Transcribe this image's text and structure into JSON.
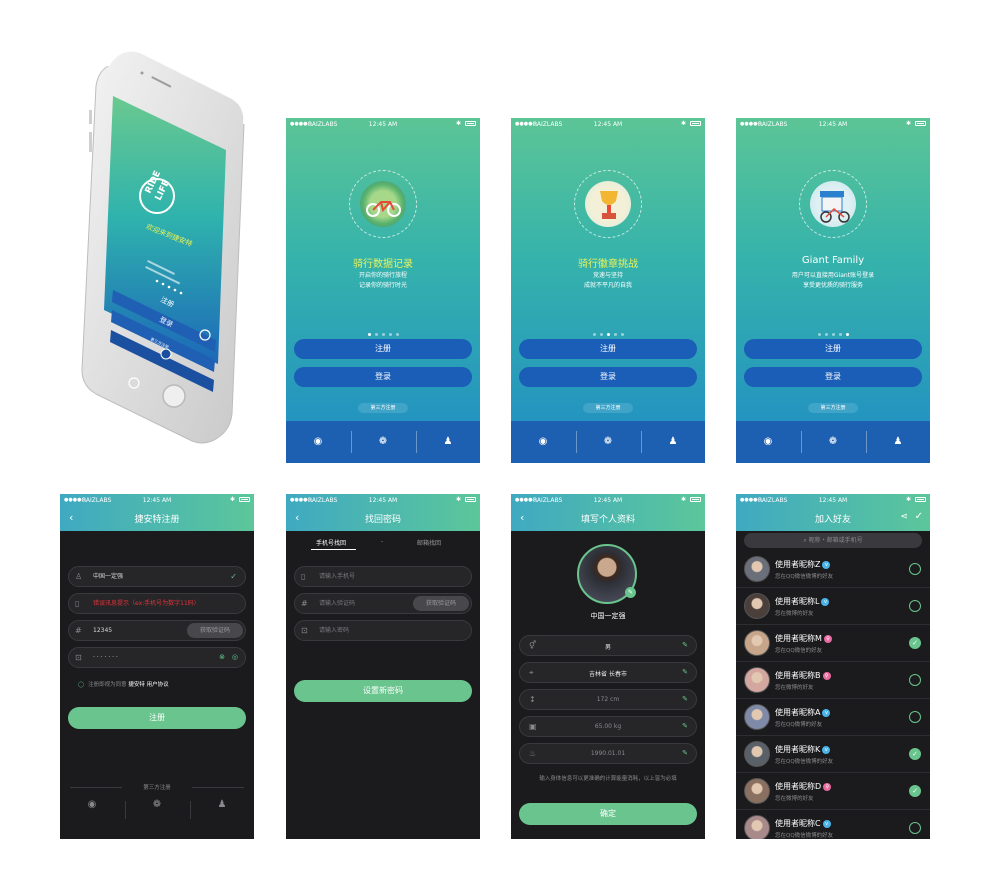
{
  "status": {
    "carrier": "RAIZLABS",
    "time": "12:45 AM"
  },
  "phone_mockup": {
    "logo_line1": "RIDE",
    "logo_line2": "LIFE",
    "welcome": "欢迎来到捷安特",
    "register": "注册",
    "login": "登录",
    "third_party": "第三方注册"
  },
  "onboarding": [
    {
      "title": "骑行数据记录",
      "desc": [
        "开启你的骑行旅程",
        "记录你的骑行时光"
      ],
      "active_page": 1,
      "accent": "#4aa86a"
    },
    {
      "title": "骑行徽章挑战",
      "desc": [
        "竞速与坚持",
        "成就不平凡的自我"
      ],
      "active_page": 3,
      "accent": "#e84a3a"
    },
    {
      "title": "Giant Family",
      "desc": [
        "用户可以直接用Giant账号登录",
        "享受更优质的骑行服务"
      ],
      "active_page": 5,
      "accent": "#2a7fcf"
    }
  ],
  "common": {
    "register": "注册",
    "login": "登录",
    "third_party": "第三方注册",
    "page_count": 5
  },
  "register_screen": {
    "title": "捷安特注册",
    "name_value": "中国一定强",
    "error_text": "错误讯息提示（ex:手机号为数字11码）",
    "code_value": "12345",
    "get_code": "获取验证码",
    "password_mask": "· · · · · · ·",
    "agree_prefix": "注册即视为同意",
    "agree_link": "捷安特 用户协议",
    "submit": "注册",
    "third_party": "第三方注册"
  },
  "recover_screen": {
    "title": "找回密码",
    "tab_phone": "手机号找回",
    "tab_sep": "-",
    "tab_email": "邮箱找回",
    "phone_placeholder": "请输入手机号",
    "code_placeholder": "请输入验证码",
    "get_code": "获取验证码",
    "password_placeholder": "请输入密码",
    "submit": "设置新密码"
  },
  "profile_screen": {
    "title": "填写个人资料",
    "name": "中国一定强",
    "gender": "男",
    "region": "吉林省 长春市",
    "height": "172 cm",
    "weight": "65.00 kg",
    "birthday": "1990.01.01",
    "note": "输入身体信息可以更准确的计算能量消耗，以上皆为必填",
    "submit": "确定"
  },
  "friends_screen": {
    "title": "加入好友",
    "search_placeholder": "昵称・邮箱或手机号",
    "friends": [
      {
        "name": "使用者昵称Z",
        "sub": "您在QQ微信微博的好友",
        "badge": "v",
        "badge_color": "#4ab3e8",
        "checked": false
      },
      {
        "name": "使用者昵称L",
        "sub": "您在微博的好友",
        "badge": "v",
        "badge_color": "#4ab3e8",
        "checked": false
      },
      {
        "name": "使用者昵称M",
        "sub": "您在QQ微信的好友",
        "badge": "♀",
        "badge_color": "#e86aa0",
        "checked": true
      },
      {
        "name": "使用者昵称B",
        "sub": "您在微博的好友",
        "badge": "♀",
        "badge_color": "#e86aa0",
        "checked": false
      },
      {
        "name": "使用者昵称A",
        "sub": "您在QQ微博的好友",
        "badge": "v",
        "badge_color": "#4ab3e8",
        "checked": false
      },
      {
        "name": "使用者昵称K",
        "sub": "您在QQ微信微博的好友",
        "badge": "v",
        "badge_color": "#4ab3e8",
        "checked": true
      },
      {
        "name": "使用者昵称D",
        "sub": "您在微博的好友",
        "badge": "♀",
        "badge_color": "#e86aa0",
        "checked": true
      },
      {
        "name": "使用者昵称C",
        "sub": "您在QQ微信微博的好友",
        "badge": "v",
        "badge_color": "#4ab3e8",
        "checked": false
      }
    ]
  },
  "icons": {
    "weibo": "weibo-icon",
    "wechat": "wechat-icon",
    "qq": "qq-icon"
  }
}
